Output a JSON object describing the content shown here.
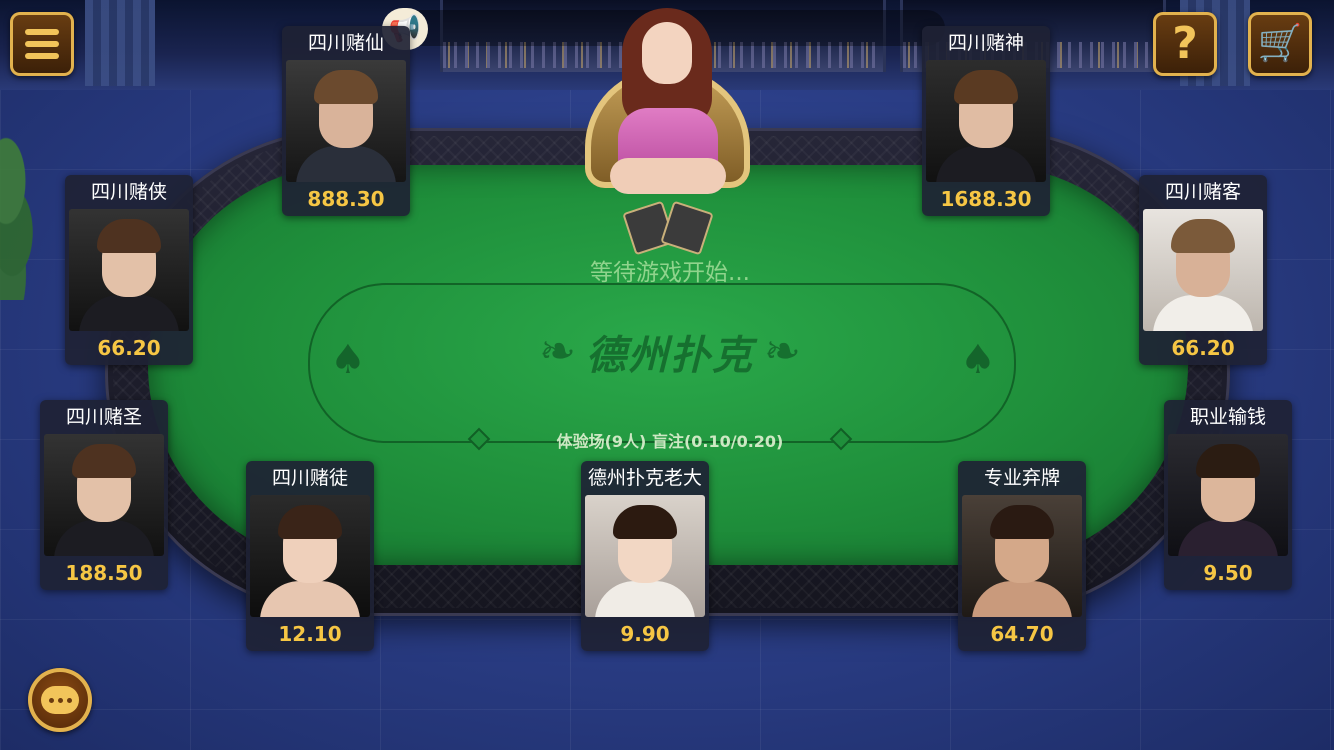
{
  "table": {
    "status_text": "等待游戏开始...",
    "logo_text": "德州扑克",
    "room_info": "体验场(9人) 盲注(0.10/0.20)"
  },
  "players": [
    {
      "name": "四川赌仙",
      "chips": "888.30"
    },
    {
      "name": "四川赌神",
      "chips": "1688.30"
    },
    {
      "name": "四川赌侠",
      "chips": "66.20"
    },
    {
      "name": "四川赌客",
      "chips": "66.20"
    },
    {
      "name": "四川赌圣",
      "chips": "188.50"
    },
    {
      "name": "职业输钱",
      "chips": "9.50"
    },
    {
      "name": "四川赌徒",
      "chips": "12.10"
    },
    {
      "name": "德州扑克老大",
      "chips": "9.90"
    },
    {
      "name": "专业弃牌",
      "chips": "64.70"
    }
  ],
  "icons": {
    "menu": "menu-icon",
    "announcement": "megaphone-icon",
    "help": "help-icon",
    "shop": "cart-icon",
    "chat": "chat-icon"
  },
  "colors": {
    "felt": "#1f8f3b",
    "chips_text": "#f6c644",
    "button_gold": "#e2b24e"
  }
}
